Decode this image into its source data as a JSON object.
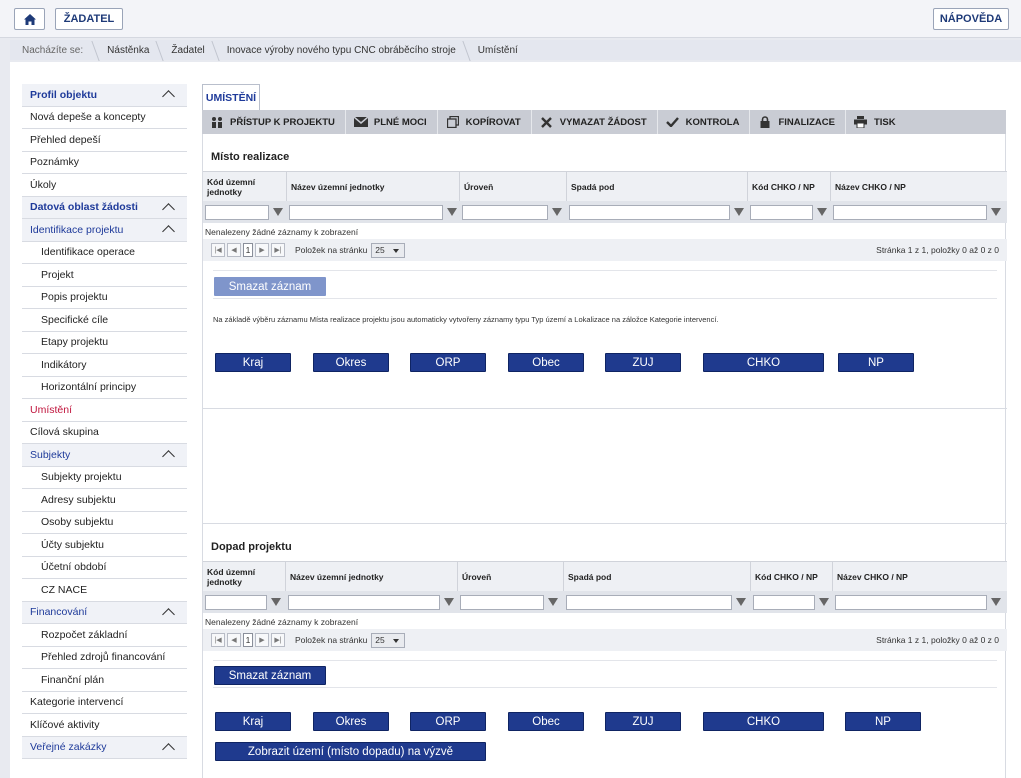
{
  "topbar": {
    "zadatel": "ŽADATEL",
    "napoveda": "NÁPOVĚDA"
  },
  "breadcrumb": {
    "label": "Nacházíte se:",
    "items": [
      "Nástěnka",
      "Žadatel",
      "Inovace výroby nového typu CNC obráběcího stroje",
      "Umístění"
    ]
  },
  "sidebar": {
    "items": [
      {
        "label": "Profil objektu",
        "type": "head",
        "chevron": true
      },
      {
        "label": "Nová depeše a koncepty",
        "type": "item"
      },
      {
        "label": "Přehled depeší",
        "type": "item"
      },
      {
        "label": "Poznámky",
        "type": "item"
      },
      {
        "label": "Úkoly",
        "type": "item"
      },
      {
        "label": "Datová oblast žádosti",
        "type": "head",
        "chevron": true
      },
      {
        "label": "Identifikace projektu",
        "type": "head2",
        "chevron": true
      },
      {
        "label": "Identifikace operace",
        "type": "sub"
      },
      {
        "label": "Projekt",
        "type": "sub"
      },
      {
        "label": "Popis projektu",
        "type": "sub"
      },
      {
        "label": "Specifické cíle",
        "type": "sub"
      },
      {
        "label": "Etapy projektu",
        "type": "sub"
      },
      {
        "label": "Indikátory",
        "type": "sub"
      },
      {
        "label": "Horizontální principy",
        "type": "sub"
      },
      {
        "label": "Umístění",
        "type": "active"
      },
      {
        "label": "Cílová skupina",
        "type": "item"
      },
      {
        "label": "Subjekty",
        "type": "head2",
        "chevron": true
      },
      {
        "label": "Subjekty projektu",
        "type": "sub"
      },
      {
        "label": "Adresy subjektu",
        "type": "sub"
      },
      {
        "label": "Osoby subjektu",
        "type": "sub"
      },
      {
        "label": "Účty subjektu",
        "type": "sub"
      },
      {
        "label": "Účetní období",
        "type": "sub"
      },
      {
        "label": "CZ NACE",
        "type": "sub"
      },
      {
        "label": "Financování",
        "type": "fin",
        "chevron": true
      },
      {
        "label": "Rozpočet základní",
        "type": "sub"
      },
      {
        "label": "Přehled zdrojů financování",
        "type": "sub"
      },
      {
        "label": "Finanční plán",
        "type": "sub"
      },
      {
        "label": "Kategorie intervencí",
        "type": "item"
      },
      {
        "label": "Klíčové aktivity",
        "type": "item"
      },
      {
        "label": "Veřejné zakázky",
        "type": "head2",
        "chevron": true
      }
    ]
  },
  "tab": {
    "label": "UMÍSTĚNÍ"
  },
  "toolbar": {
    "items": [
      "PŘÍSTUP K PROJEKTU",
      "PLNÉ MOCI",
      "KOPÍROVAT",
      "VYMAZAT ŽÁDOST",
      "KONTROLA",
      "FINALIZACE",
      "TISK"
    ]
  },
  "misto": {
    "title": "Místo realizace",
    "columns": [
      "Kód územní jednotky",
      "Název územní jednotky",
      "Úroveň",
      "Spadá pod",
      "Kód CHKO / NP",
      "Název CHKO / NP"
    ],
    "nodata": "Nenalezeny žádné záznamy k zobrazení",
    "page": "1",
    "per_page_label": "Položek na stránku",
    "per_page": "25",
    "page_info": "Stránka 1 z 1, položky 0 až 0 z 0",
    "delete": "Smazat záznam",
    "info": "Na základě výběru záznamu Místa realizace projektu jsou automaticky vytvořeny záznamy typu Typ území a Lokalizace na záložce Kategorie intervencí.",
    "buttons": [
      "Kraj",
      "Okres",
      "ORP",
      "Obec",
      "ZUJ",
      "CHKO",
      "NP"
    ]
  },
  "dopad": {
    "title": "Dopad projektu",
    "columns": [
      "Kód územní jednotky",
      "Název územní jednotky",
      "Úroveň",
      "Spadá pod",
      "Kód CHKO / NP",
      "Název CHKO / NP"
    ],
    "nodata": "Nenalezeny žádné záznamy k zobrazení",
    "page": "1",
    "per_page_label": "Položek na stránku",
    "per_page": "25",
    "page_info": "Stránka 1 z 1, položky 0 až 0 z 0",
    "delete": "Smazat záznam",
    "buttons": [
      "Kraj",
      "Okres",
      "ORP",
      "Obec",
      "ZUJ",
      "CHKO",
      "NP"
    ],
    "show": "Zobrazit území (místo dopadu) na výzvě"
  }
}
